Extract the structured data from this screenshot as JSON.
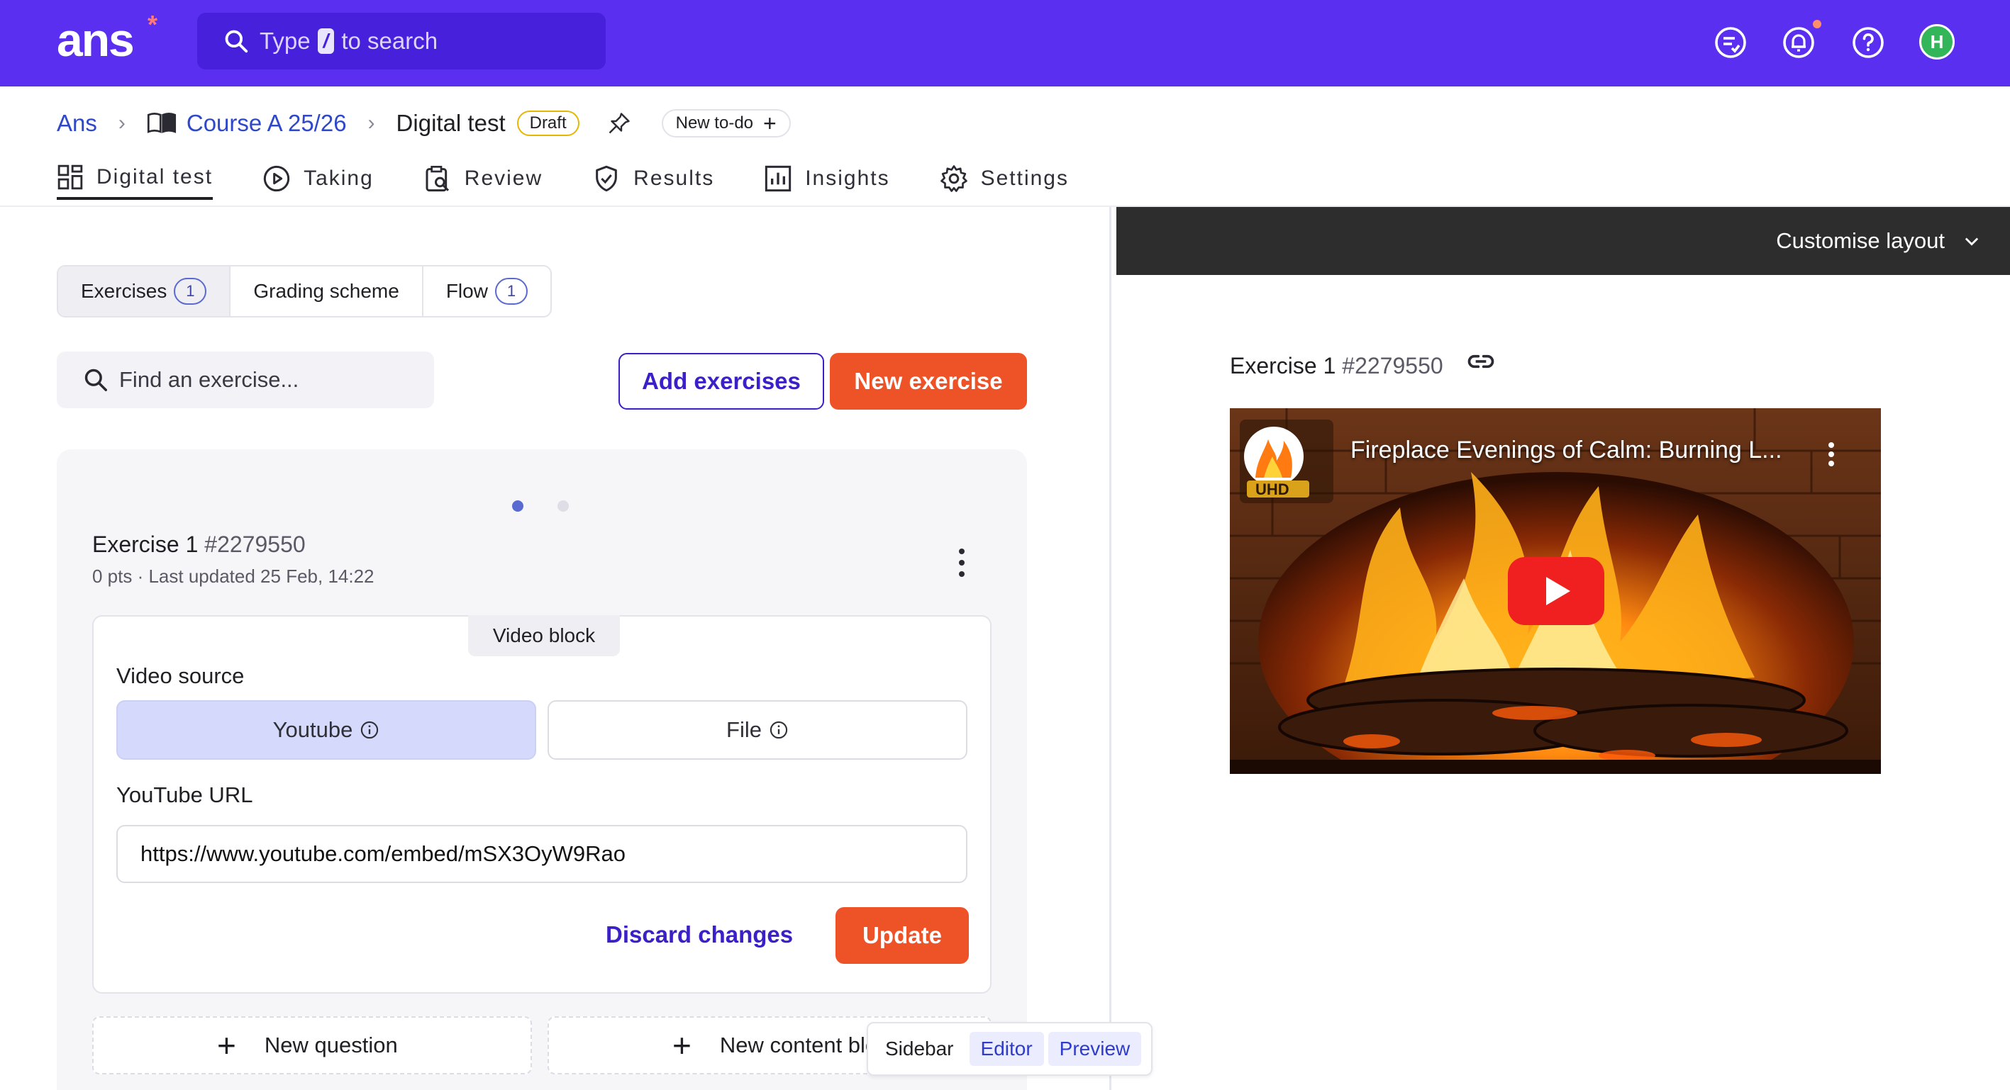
{
  "app": {
    "logo": "ans",
    "logo_mark": "*"
  },
  "search": {
    "prefix": "Type",
    "key": "/",
    "suffix": "to search"
  },
  "user": {
    "initial": "H"
  },
  "breadcrumb": {
    "root": "Ans",
    "course": "Course A 25/26",
    "current": "Digital test",
    "status": "Draft",
    "new_todo": "New to-do"
  },
  "tabs": [
    {
      "label": "Digital test",
      "icon": "dashboard-icon",
      "active": true
    },
    {
      "label": "Taking",
      "icon": "play-circle-icon"
    },
    {
      "label": "Review",
      "icon": "clipboard-search-icon"
    },
    {
      "label": "Results",
      "icon": "shield-check-icon"
    },
    {
      "label": "Insights",
      "icon": "bar-chart-icon"
    },
    {
      "label": "Settings",
      "icon": "gear-icon"
    }
  ],
  "segments": {
    "exercises": "Exercises",
    "exercises_count": "1",
    "grading": "Grading scheme",
    "flow": "Flow",
    "flow_count": "1"
  },
  "find": {
    "placeholder": "Find an exercise..."
  },
  "actions": {
    "add": "Add exercises",
    "new": "New exercise"
  },
  "exercise": {
    "title": "Exercise 1",
    "id": "#2279550",
    "meta": "0 pts · Last updated 25 Feb, 14:22",
    "block_label": "Video block",
    "source_label": "Video source",
    "source_youtube": "Youtube",
    "source_file": "File",
    "url_label": "YouTube URL",
    "url_value": "https://www.youtube.com/embed/mSX3OyW9Rao",
    "discard": "Discard changes",
    "update": "Update",
    "new_question": "New question",
    "new_content": "New content block"
  },
  "view_toggle": {
    "sidebar": "Sidebar",
    "editor": "Editor",
    "preview": "Preview"
  },
  "preview": {
    "customise": "Customise layout",
    "title": "Exercise 1",
    "id": "#2279550",
    "video_title": "Fireplace Evenings of Calm: Burning L...",
    "channel_badge": "UHD"
  },
  "colors": {
    "brand": "#5a2ff0",
    "accent_orange": "#ee5227",
    "link_blue": "#2e48c9",
    "selected_option": "#d5d9fb"
  }
}
